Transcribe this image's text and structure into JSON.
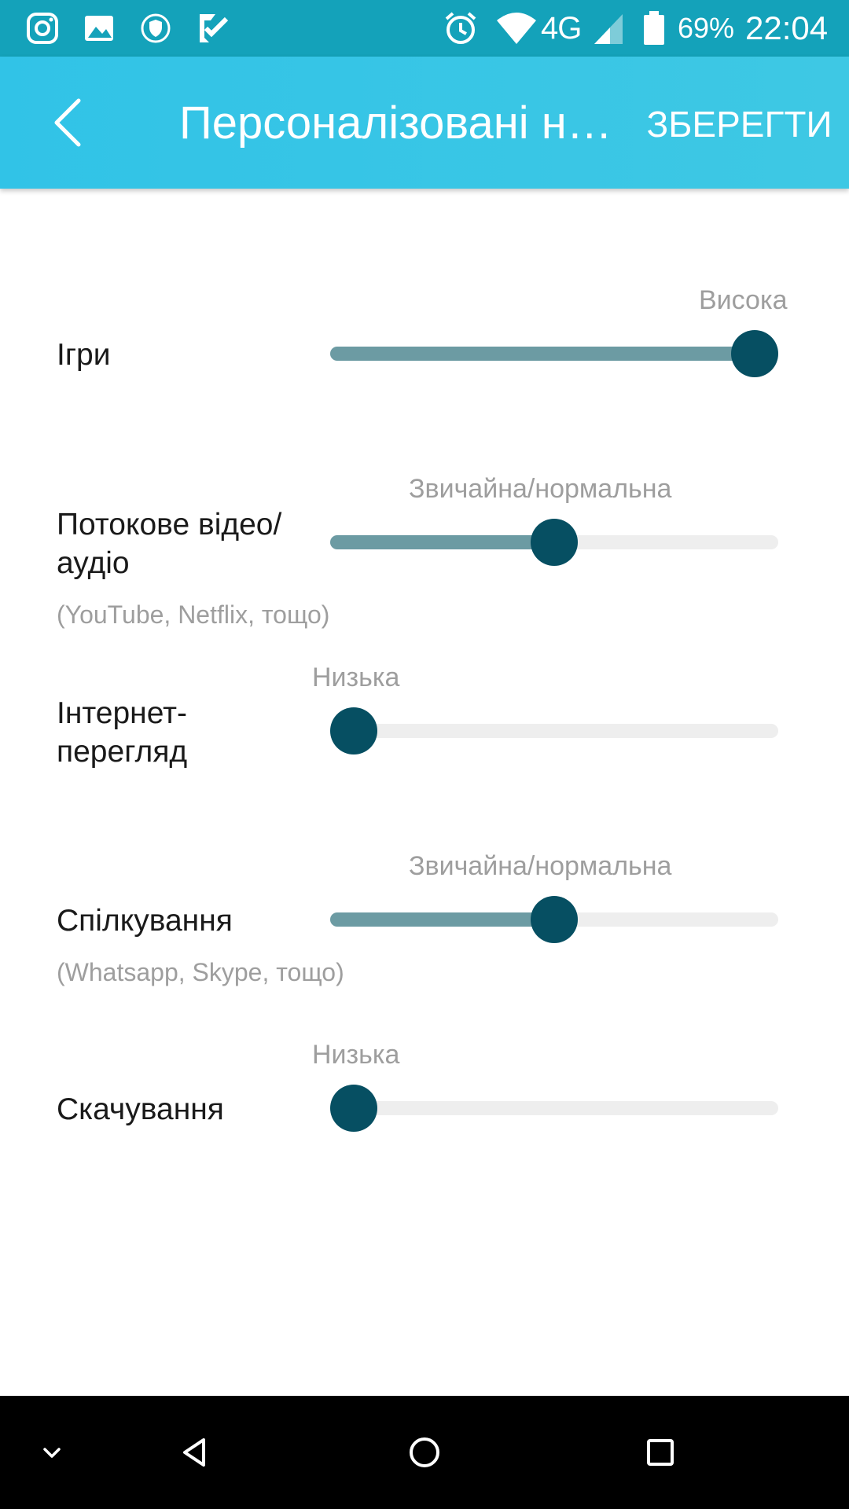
{
  "status_bar": {
    "icons": [
      "instagram-icon",
      "gallery-icon",
      "vpn-shield-icon",
      "task-check-icon",
      "alarm-icon",
      "wifi-icon",
      "signal-icon",
      "battery-icon"
    ],
    "network": "4G",
    "battery": "69%",
    "time": "22:04"
  },
  "app_bar": {
    "back_icon": "chevron-left-icon",
    "title": "Персоналізовані н…",
    "save_label": "ЗБЕРЕГТИ"
  },
  "rows": [
    {
      "label": "Ігри",
      "subtitle": "",
      "level_label": "Висока",
      "value": 1.0
    },
    {
      "label": "Потокове відео/аудіо",
      "subtitle": "(YouTube, Netflix, тощо)",
      "level_label": "Звичайна/нормальна",
      "value": 0.5
    },
    {
      "label": "Інтернет-перегляд",
      "subtitle": "",
      "level_label": "Низька",
      "value": 0.0
    },
    {
      "label": "Спілкування",
      "subtitle": "(Whatsapp, Skype, тощо)",
      "level_label": "Звичайна/нормальна",
      "value": 0.5
    },
    {
      "label": "Скачування",
      "subtitle": "",
      "level_label": "Низька",
      "value": 0.0
    }
  ],
  "nav_bar": {
    "icons": [
      "chevron-down-icon",
      "back-triangle-icon",
      "home-circle-icon",
      "recents-square-icon"
    ]
  },
  "colors": {
    "status_bar": "#14a2ba",
    "app_bar": "#35c5e6",
    "slider_fill": "#6c9ba3",
    "slider_track": "#eeeeee",
    "slider_thumb": "#064f62"
  }
}
